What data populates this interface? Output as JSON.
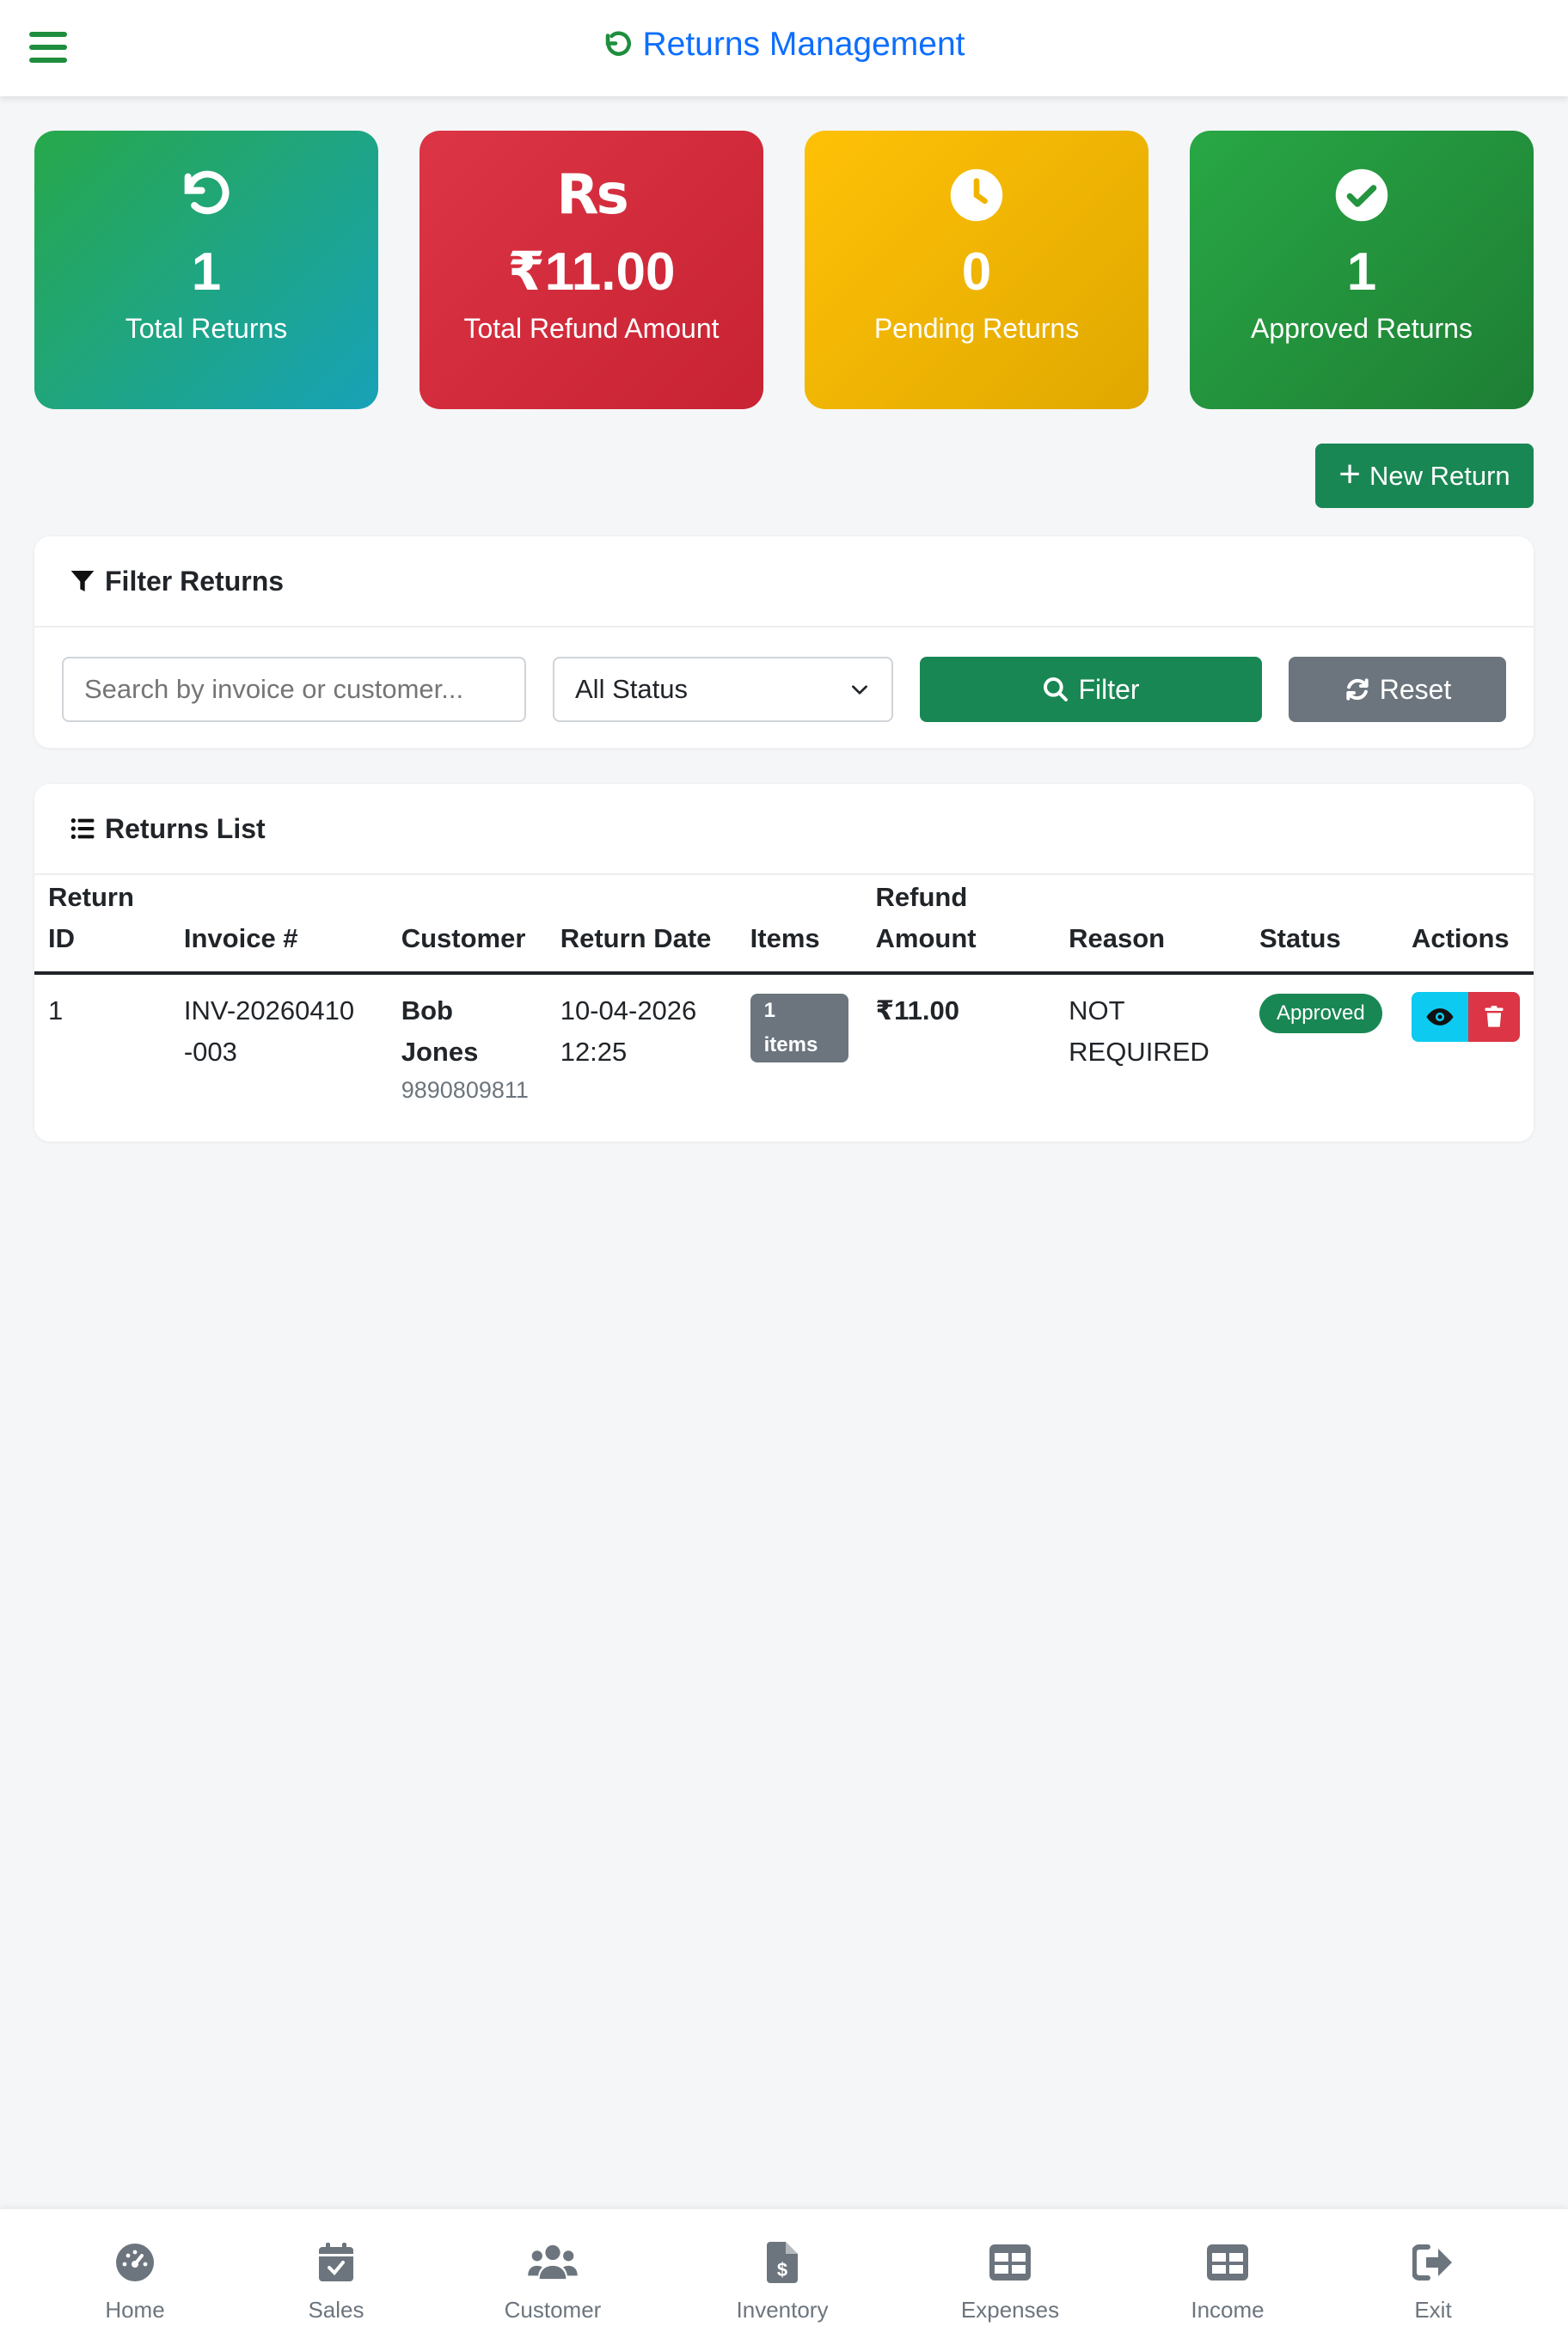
{
  "header": {
    "title": "Returns Management"
  },
  "stats": [
    {
      "value": "1",
      "label": "Total Returns",
      "icon": "undo-icon"
    },
    {
      "value": "₹11.00",
      "label": "Total Refund Amount",
      "icon": "rupee-icon",
      "icon_text": "Rs"
    },
    {
      "value": "0",
      "label": "Pending Returns",
      "icon": "clock-icon"
    },
    {
      "value": "1",
      "label": "Approved Returns",
      "icon": "check-circle-icon"
    }
  ],
  "actions": {
    "new_return_label": "New Return"
  },
  "filter": {
    "title": "Filter Returns",
    "search_placeholder": "Search by invoice or customer...",
    "status_selected": "All Status",
    "filter_label": "Filter",
    "reset_label": "Reset"
  },
  "list": {
    "title": "Returns List",
    "columns": [
      "Return ID",
      "Invoice #",
      "Customer",
      "Return Date",
      "Items",
      "Refund Amount",
      "Reason",
      "Status",
      "Actions"
    ],
    "rows": [
      {
        "return_id": "1",
        "invoice": "INV-20260410-003",
        "customer_name": "Bob Jones",
        "customer_phone": "9890809811",
        "return_date": "10-04-2026 12:25",
        "items": "1 items",
        "refund_amount": "₹11.00",
        "reason": "NOT REQUIRED",
        "status": "Approved"
      }
    ]
  },
  "bottom_nav": [
    {
      "label": "Home",
      "icon": "dashboard-gauge-icon"
    },
    {
      "label": "Sales",
      "icon": "calendar-check-icon"
    },
    {
      "label": "Customer",
      "icon": "users-icon"
    },
    {
      "label": "Inventory",
      "icon": "invoice-dollar-icon"
    },
    {
      "label": "Expenses",
      "icon": "table-icon"
    },
    {
      "label": "Income",
      "icon": "table-icon"
    },
    {
      "label": "Exit",
      "icon": "sign-out-icon"
    }
  ],
  "colors": {
    "primary_green": "#198754",
    "link_blue": "#0d6efd",
    "danger": "#dc3545",
    "warning": "#ffc107",
    "info": "#0dcaf0",
    "secondary": "#6c757d"
  }
}
